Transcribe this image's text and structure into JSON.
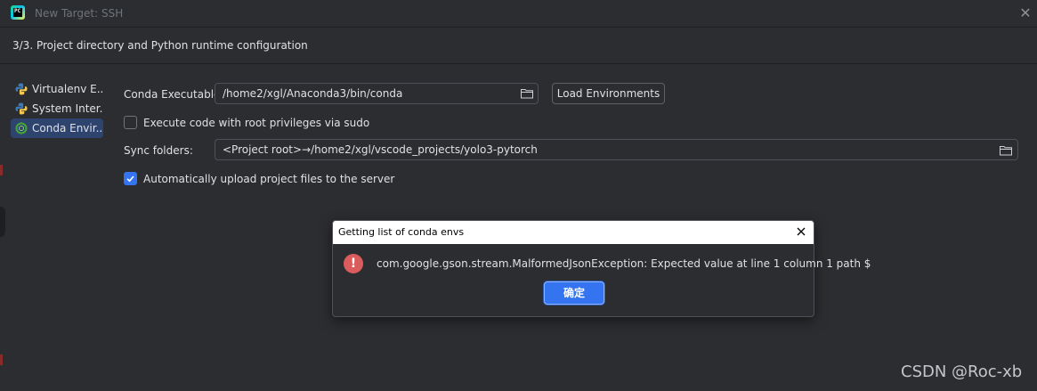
{
  "window": {
    "title": "New Target: SSH",
    "logo_text": "PC"
  },
  "step": {
    "label": "3/3. Project directory and Python runtime configuration"
  },
  "sidebar": {
    "items": [
      {
        "label": "Virtualenv E...",
        "icon": "python-icon",
        "selected": false
      },
      {
        "label": "System Inter...",
        "icon": "python-icon",
        "selected": false
      },
      {
        "label": "Conda Envir...",
        "icon": "conda-icon",
        "selected": true
      }
    ]
  },
  "form": {
    "conda_label": "Conda Executable:",
    "conda_value": "/home2/xgl/Anaconda3/bin/conda",
    "load_button": "Load Environments",
    "sudo_label": "Execute code with root privileges via sudo",
    "sudo_checked": false,
    "sync_label": "Sync folders:",
    "sync_value": "<Project root>→/home2/xgl/vscode_projects/yolo3-pytorch",
    "upload_label": "Automatically upload project files to the server",
    "upload_checked": true
  },
  "dialog": {
    "title": "Getting list of conda envs",
    "message": "com.google.gson.stream.MalformedJsonException: Expected value at line 1 column 1 path $",
    "ok_button": "确定",
    "icon": "error-icon"
  },
  "watermark": "CSDN @Roc-xb",
  "colors": {
    "background": "#2b2d30",
    "accent": "#3574f0",
    "selection": "#2e436e",
    "error": "#db5c5c"
  }
}
